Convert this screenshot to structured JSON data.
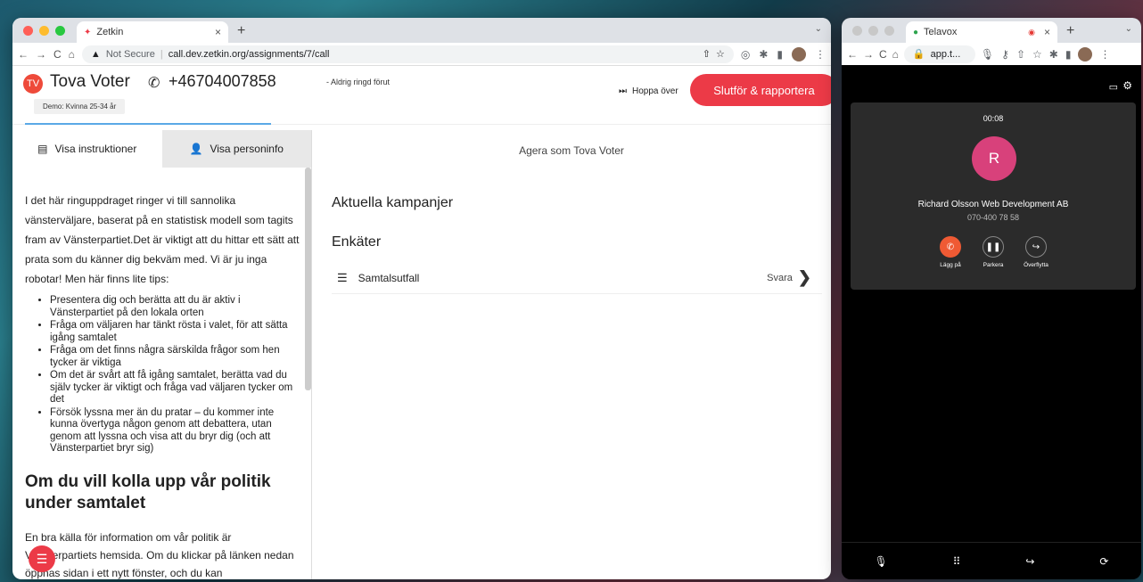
{
  "zetkin_window": {
    "tab_title": "Zetkin",
    "url_warning": "Not Secure",
    "url": "call.dev.zetkin.org/assignments/7/call",
    "header": {
      "initials": "TV",
      "name": "Tova Voter",
      "phone": "+46704007858",
      "status": "- Aldrig ringd förut",
      "tag": "Demo: Kvinna 25-34 år",
      "skip_label": "Hoppa över",
      "finish_label": "Slutför & rapportera"
    },
    "left_tabs": [
      {
        "label": "Visa instruktioner"
      },
      {
        "label": "Visa personinfo"
      }
    ],
    "instructions": {
      "intro": "I det här ringuppdraget ringer vi till sannolika vänsterväljare, baserat på en statistisk modell som tagits fram av Vänsterpartiet.Det är viktigt att du hittar ett sätt att prata som du känner dig bekväm med. Vi är ju inga robotar! Men här finns lite tips:",
      "tips": [
        "Presentera dig och berätta att du är aktiv i Vänsterpartiet på den lokala orten",
        "Fråga om väljaren har tänkt rösta i valet, för att sätta igång samtalet",
        "Fråga om det finns några särskilda frågor som hen tycker är viktiga",
        "Om det är svårt att få igång samtalet, berätta vad du själv tycker är viktigt och fråga vad väljaren tycker om det",
        "Försök lyssna mer än du pratar – du kommer inte kunna övertyga någon genom att debattera, utan genom att lyssna och visa att du bryr dig (och att Vänsterpartiet bryr sig)"
      ],
      "heading": "Om du vill kolla upp vår politik under samtalet",
      "tail": "En bra källa för information om vår politik är Vänsterpartiets hemsida. Om du klickar på länken nedan öppnas sidan i ett nytt fönster, och du kan"
    },
    "main": {
      "act_as": "Agera som Tova Voter",
      "campaigns_title": "Aktuella kampanjer",
      "surveys_title": "Enkäter",
      "survey_item": "Samtalsutfall",
      "answer_label": "Svara"
    }
  },
  "telavox_window": {
    "tab_title": "Telavox",
    "url": "app.t...",
    "timer": "00:08",
    "avatar_letter": "R",
    "caller_name": "Richard Olsson Web Development AB",
    "caller_phone": "070-400 78 58",
    "buttons": [
      {
        "label": "Lägg på",
        "icon": "hangup-icon"
      },
      {
        "label": "Parkera",
        "icon": "pause-icon"
      },
      {
        "label": "Överflytta",
        "icon": "transfer-icon"
      }
    ]
  }
}
